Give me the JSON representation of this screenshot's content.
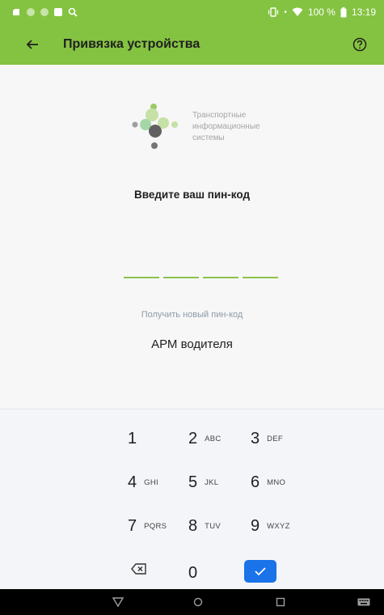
{
  "status_bar": {
    "battery_text": "100 %",
    "time": "13:19"
  },
  "app_bar": {
    "title": "Привязка устройства"
  },
  "logo": {
    "line1": "Транспортные",
    "line2": "информационные",
    "line3": "системы"
  },
  "pin": {
    "prompt": "Введите ваш пин-код",
    "new_pin_link": "Получить новый пин-код"
  },
  "app_name": "АРМ водителя",
  "keypad": {
    "keys": [
      {
        "num": "1",
        "letters": ""
      },
      {
        "num": "2",
        "letters": "ABC"
      },
      {
        "num": "3",
        "letters": "DEF"
      },
      {
        "num": "4",
        "letters": "GHI"
      },
      {
        "num": "5",
        "letters": "JKL"
      },
      {
        "num": "6",
        "letters": "MNO"
      },
      {
        "num": "7",
        "letters": "PQRS"
      },
      {
        "num": "8",
        "letters": "TUV"
      },
      {
        "num": "9",
        "letters": "WXYZ"
      }
    ],
    "zero": "0"
  },
  "colors": {
    "brand_green": "#84c341",
    "accent_blue": "#1a73e8"
  }
}
